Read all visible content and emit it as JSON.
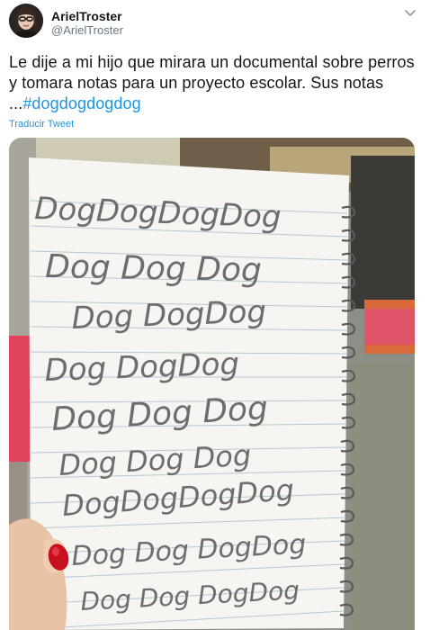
{
  "author": {
    "display_name": "ArielTroster",
    "handle": "@ArielTroster"
  },
  "tweet": {
    "text": "Le dije a mi hijo que mirara un documental sobre perros y tomara notas para un proyecto escolar. Sus notas ...",
    "hashtag": "#dogdogdogdog",
    "translate_label": "Traducir Tweet"
  },
  "media": {
    "handwriting_lines": [
      "DogDogDogDog",
      "Dog Dog Dog",
      "Dog DogDog",
      "Dog DogDog",
      "Dog Dog Dog",
      "Dog Dog Dog",
      "DogDogDogDog",
      "Dog Dog DogDog",
      "Dog Dog DogDog"
    ]
  },
  "icons": {
    "caret": "chevron-down-icon"
  },
  "colors": {
    "link": "#1b95e0",
    "secondary_text": "#657786",
    "primary_text": "#14171a",
    "nail_polish": "#c8101e"
  }
}
